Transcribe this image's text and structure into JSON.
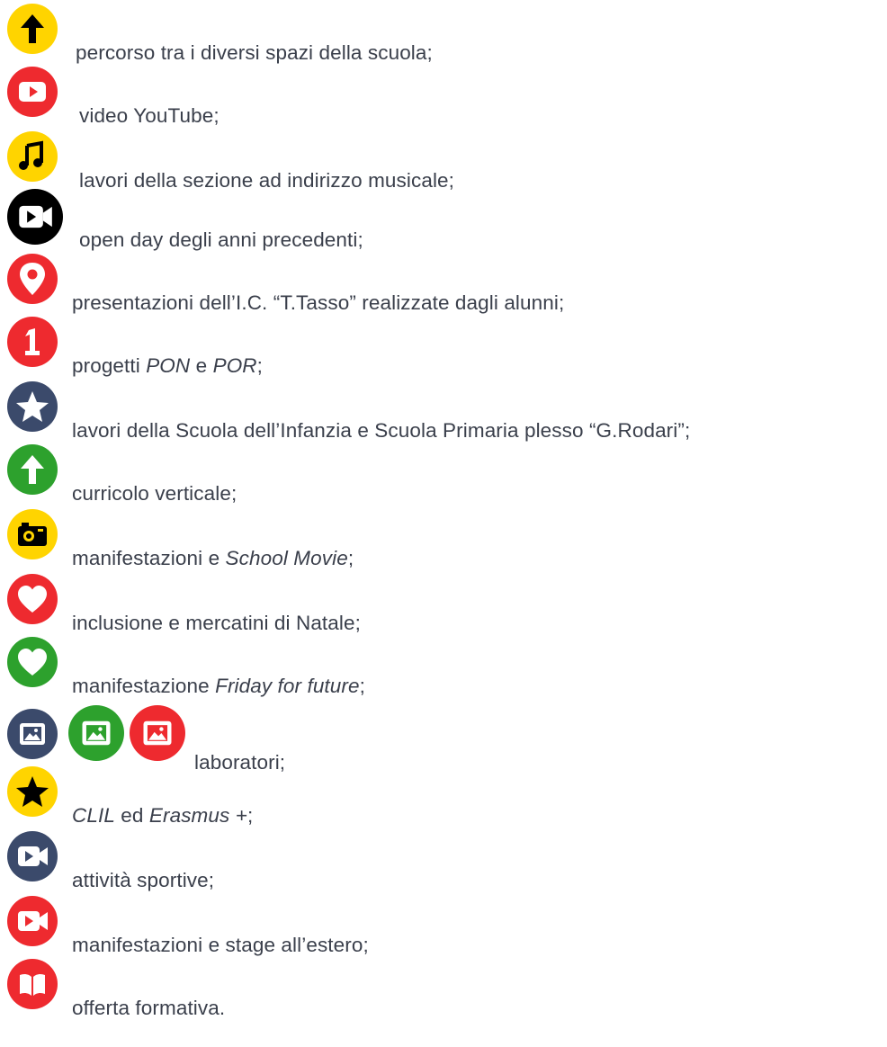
{
  "legend": {
    "items": [
      {
        "icon": "arrow-up-icon",
        "color": "#ffd400",
        "parts": [
          "percorso tra i diversi spazi della scuola;"
        ]
      },
      {
        "icon": "youtube-play-icon",
        "color": "#ee2a2f",
        "parts": [
          "video YouTube;"
        ]
      },
      {
        "icon": "music-note-icon",
        "color": "#ffd400",
        "parts": [
          "lavori della sezione ad indirizzo musicale;"
        ]
      },
      {
        "icon": "video-camera-icon",
        "color": "#000000",
        "parts": [
          "open day degli anni precedenti;"
        ]
      },
      {
        "icon": "map-pin-icon",
        "color": "#ee2a2f",
        "parts": [
          "presentazioni dell’I.C. “T.Tasso” realizzate dagli alunni;"
        ]
      },
      {
        "icon": "number-one-icon",
        "color": "#ee2a2f",
        "parts": [
          "progetti ",
          "PON",
          " e ",
          "POR",
          ";"
        ]
      },
      {
        "icon": "star-icon",
        "color": "#3b4a6b",
        "parts": [
          "lavori della Scuola dell’Infanzia e Scuola Primaria plesso “G.Rodari”;"
        ]
      },
      {
        "icon": "arrow-up-icon",
        "color": "#2da12d",
        "parts": [
          "curricolo verticale;"
        ]
      },
      {
        "icon": "camera-icon",
        "color": "#ffd400",
        "parts": [
          "manifestazioni e ",
          "School Movie",
          ";"
        ]
      },
      {
        "icon": "heart-icon",
        "color": "#ee2a2f",
        "parts": [
          "inclusione e mercatini di Natale;"
        ]
      },
      {
        "icon": "heart-icon",
        "color": "#2da12d",
        "parts": [
          "manifestazione ",
          "Friday for future",
          ";"
        ]
      },
      {
        "icons": [
          "image-icon",
          "image-icon",
          "image-icon"
        ],
        "colors": [
          "#3b4a6b",
          "#2da12d",
          "#ee2a2f"
        ],
        "parts": [
          "laboratori;"
        ]
      },
      {
        "icon": "star-icon",
        "color": "#ffd400",
        "parts": [
          "CLIL",
          " ed ",
          "Erasmus +",
          ";"
        ]
      },
      {
        "icon": "video-camera-icon",
        "color": "#3b4a6b",
        "parts": [
          "attività sportive;"
        ]
      },
      {
        "icon": "video-camera-icon",
        "color": "#ee2a2f",
        "parts": [
          "manifestazioni e stage all’estero;"
        ]
      },
      {
        "icon": "open-book-icon",
        "color": "#ee2a2f",
        "parts": [
          "offerta formativa."
        ]
      }
    ]
  }
}
